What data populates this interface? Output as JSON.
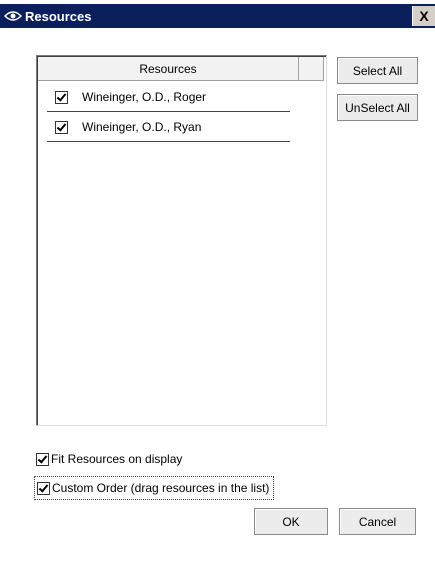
{
  "window": {
    "title": "Resources",
    "close_glyph": "X"
  },
  "list": {
    "column_header": "Resources",
    "rows": [
      {
        "label": "Wineinger, O.D., Roger",
        "checked": true
      },
      {
        "label": "Wineinger, O.D., Ryan",
        "checked": true
      }
    ]
  },
  "side_buttons": {
    "select_all": "Select All",
    "unselect_all": "UnSelect All"
  },
  "options": {
    "fit_label": "Fit Resources on display",
    "fit_checked": true,
    "custom_label": "Custom Order (drag resources in the list)",
    "custom_checked": true
  },
  "footer": {
    "ok": "OK",
    "cancel": "Cancel"
  },
  "colors": {
    "titlebar": "#0a1f5c",
    "button_face": "#ececec"
  },
  "icons": [
    "app-eye-icon",
    "close-icon",
    "checkbox-checked-icon"
  ]
}
